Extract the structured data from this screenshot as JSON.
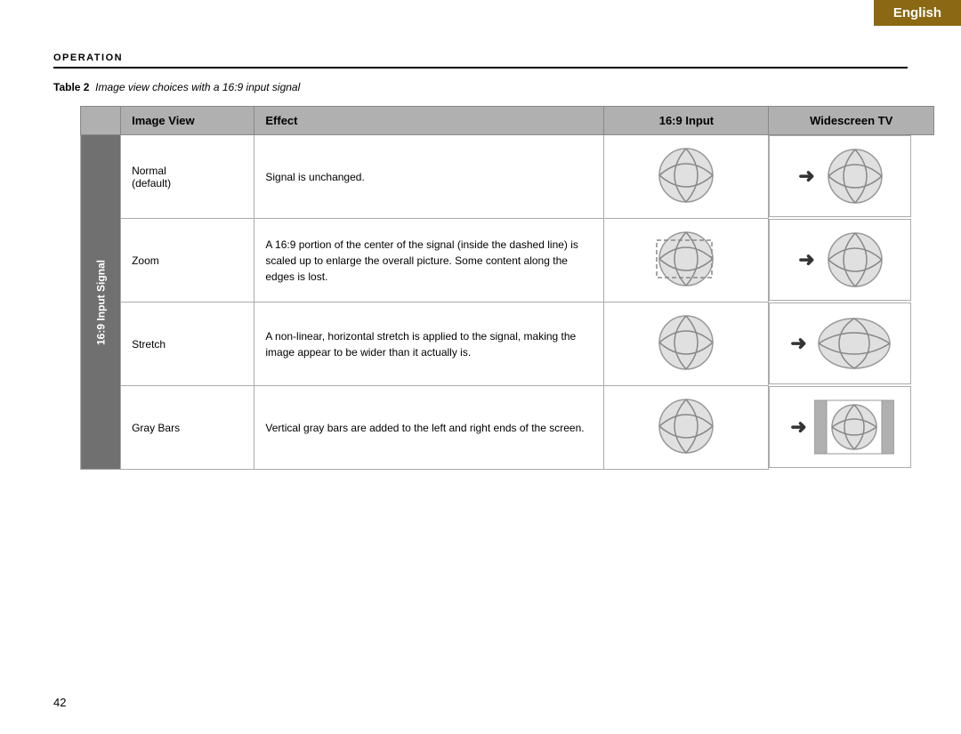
{
  "english_tab": "English",
  "operation": {
    "label": "Operation"
  },
  "table_caption": {
    "table_label": "Table 2",
    "caption_text": "Image view choices with a 16:9 input signal"
  },
  "table": {
    "headers": {
      "image_view": "Image View",
      "effect": "Effect",
      "input_16_9": "16:9 Input",
      "widescreen": "Widescreen TV"
    },
    "row_label": "16:9 Input Signal",
    "rows": [
      {
        "image_view": "Normal\n(default)",
        "effect": "Signal is unchanged.",
        "type": "normal"
      },
      {
        "image_view": "Zoom",
        "effect": "A 16:9 portion of the center of the signal (inside the dashed line) is scaled up to enlarge the overall picture. Some content along the edges is lost.",
        "type": "zoom"
      },
      {
        "image_view": "Stretch",
        "effect": "A non-linear, horizontal stretch is applied to the signal, making the image appear to be wider than it actually is.",
        "type": "stretch"
      },
      {
        "image_view": "Gray Bars",
        "effect": "Vertical gray bars are added to the left and right ends of the screen.",
        "type": "graybars"
      }
    ]
  },
  "page_number": "42"
}
